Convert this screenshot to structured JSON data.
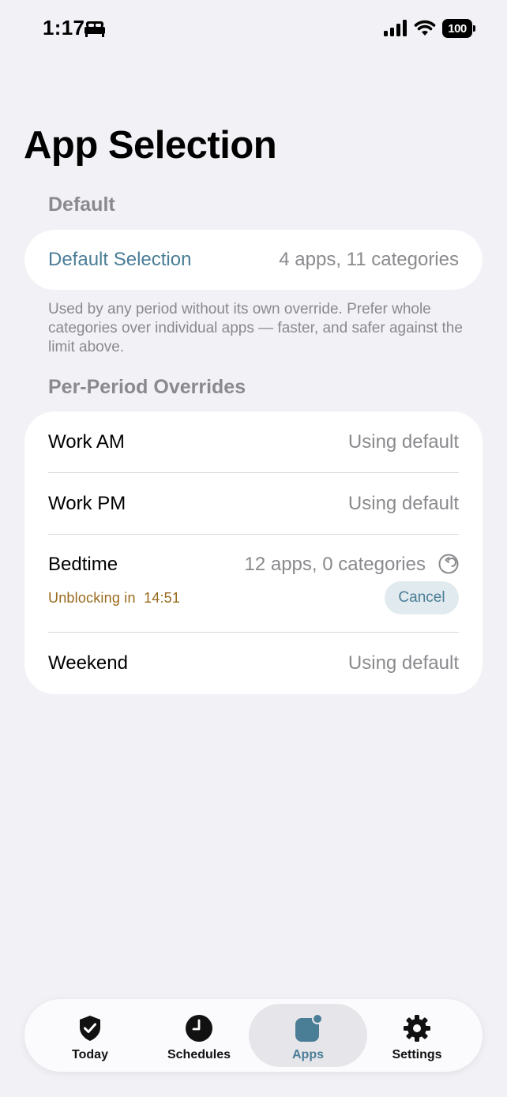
{
  "status_bar": {
    "time": "1:17",
    "battery": "100",
    "icons": [
      "bed-icon",
      "signal-icon",
      "wifi-icon",
      "battery-icon"
    ]
  },
  "page_title": "App Selection",
  "default_section": {
    "header": "Default",
    "row": {
      "label": "Default Selection",
      "value": "4 apps, 11 categories"
    },
    "footnote": "Used by any period without its own override. Prefer whole categories over individual apps — faster, and safer against the limit above."
  },
  "overrides_section": {
    "header": "Per-Period Overrides",
    "rows": [
      {
        "label": "Work AM",
        "value": "Using default"
      },
      {
        "label": "Work PM",
        "value": "Using default"
      },
      {
        "label": "Bedtime",
        "value": "12 apps, 0 categories",
        "status": "Unblocking in  14:51",
        "action": "Cancel",
        "icon": "revert-icon"
      },
      {
        "label": "Weekend",
        "value": "Using default"
      }
    ]
  },
  "tab_bar": {
    "tabs": [
      {
        "label": "Today",
        "icon": "shield-check-icon",
        "active": false
      },
      {
        "label": "Schedules",
        "icon": "clock-icon",
        "active": false
      },
      {
        "label": "Apps",
        "icon": "app-badge-icon",
        "active": true
      },
      {
        "label": "Settings",
        "icon": "gear-icon",
        "active": false
      }
    ]
  },
  "colors": {
    "background": "#f1f1f6",
    "accent": "#4a7d96",
    "secondary_text": "#8a8a8e",
    "warning_text": "#9a6a1d",
    "card": "#ffffff"
  }
}
